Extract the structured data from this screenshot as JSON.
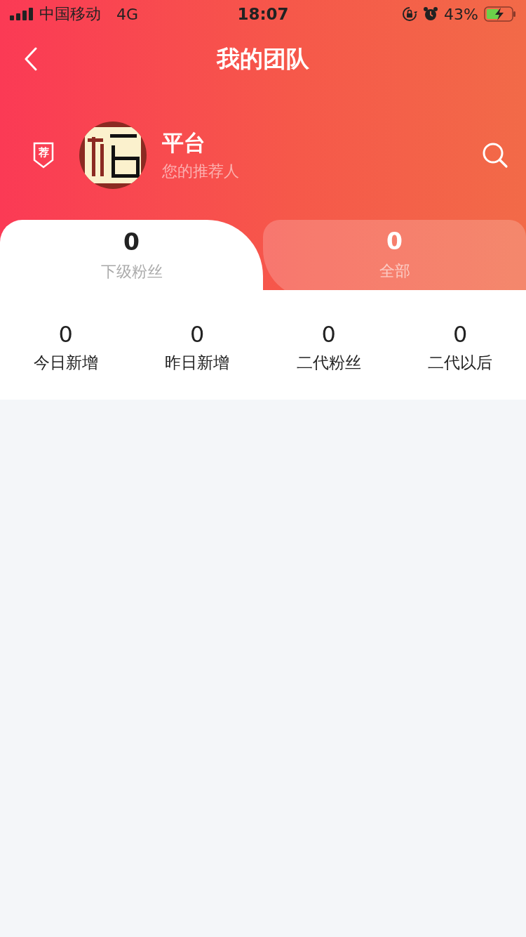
{
  "status_bar": {
    "carrier": "中国移动",
    "network": "4G",
    "time": "18:07",
    "battery": "43%"
  },
  "nav": {
    "title": "我的团队"
  },
  "referrer": {
    "badge": "荐",
    "name": "平台",
    "subtitle": "您的推荐人"
  },
  "tabs": [
    {
      "count": "0",
      "label": "下级粉丝",
      "selected": true
    },
    {
      "count": "0",
      "label": "全部",
      "selected": false
    }
  ],
  "stats": [
    {
      "value": "0",
      "label": "今日新增"
    },
    {
      "value": "0",
      "label": "昨日新增"
    },
    {
      "value": "0",
      "label": "二代粉丝"
    },
    {
      "value": "0",
      "label": "二代以后"
    }
  ]
}
